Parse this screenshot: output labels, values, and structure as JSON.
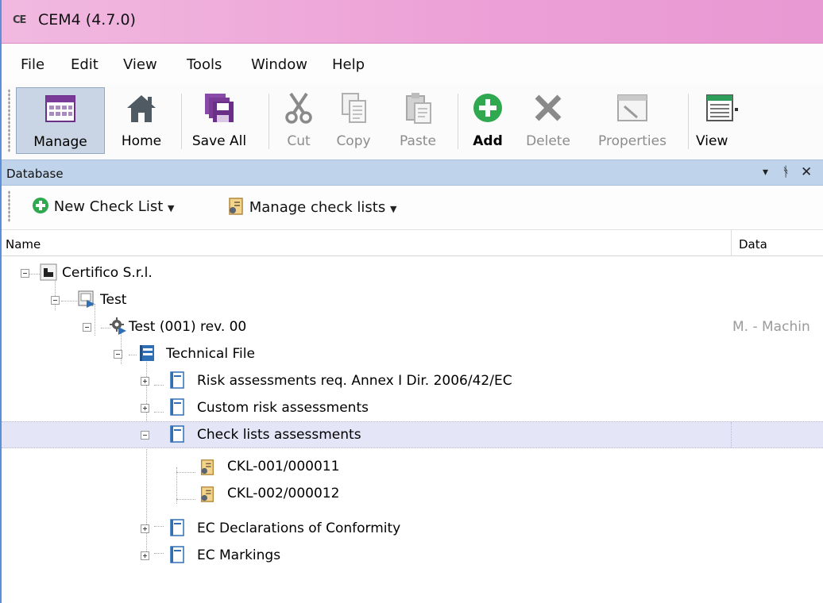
{
  "window": {
    "logo": "CE",
    "title": "CEM4 (4.7.0)"
  },
  "menu": [
    "File",
    "Edit",
    "View",
    "Tools",
    "Window",
    "Help"
  ],
  "toolbar": {
    "manage": "Manage",
    "home": "Home",
    "save_all": "Save All",
    "cut": "Cut",
    "copy": "Copy",
    "paste": "Paste",
    "add": "Add",
    "delete": "Delete",
    "properties": "Properties",
    "view": "View"
  },
  "panel": {
    "title": "Database",
    "dropdown_glyph": "▾",
    "pin_glyph": "ᚬ",
    "close_glyph": "✕"
  },
  "subtoolbar": {
    "new_check_list": "New Check List",
    "manage_check_lists": "Manage check lists"
  },
  "columns": {
    "name": "Name",
    "data": "Data"
  },
  "tree": [
    {
      "label": "Certifico S.r.l.",
      "data": ""
    },
    {
      "label": "Test",
      "data": ""
    },
    {
      "label": "Test (001) rev. 00",
      "data": "M. - Machin"
    },
    {
      "label": "Technical File",
      "data": ""
    },
    {
      "label": "Risk assessments req. Annex I Dir. 2006/42/EC",
      "data": ""
    },
    {
      "label": "Custom risk assessments",
      "data": ""
    },
    {
      "label": "Check lists assessments",
      "data": "",
      "selected": true
    },
    {
      "label": "CKL-001/000011",
      "data": ""
    },
    {
      "label": "CKL-002/000012",
      "data": ""
    },
    {
      "label": "EC Declarations of Conformity",
      "data": ""
    },
    {
      "label": "EC Markings",
      "data": ""
    }
  ],
  "colors": {
    "titlebar": "#ec9fd6",
    "panel_header": "#bfd3ea",
    "selected_row": "#e4e6f7",
    "accent_green": "#2fa84f",
    "accent_blue": "#2f6fb5"
  }
}
